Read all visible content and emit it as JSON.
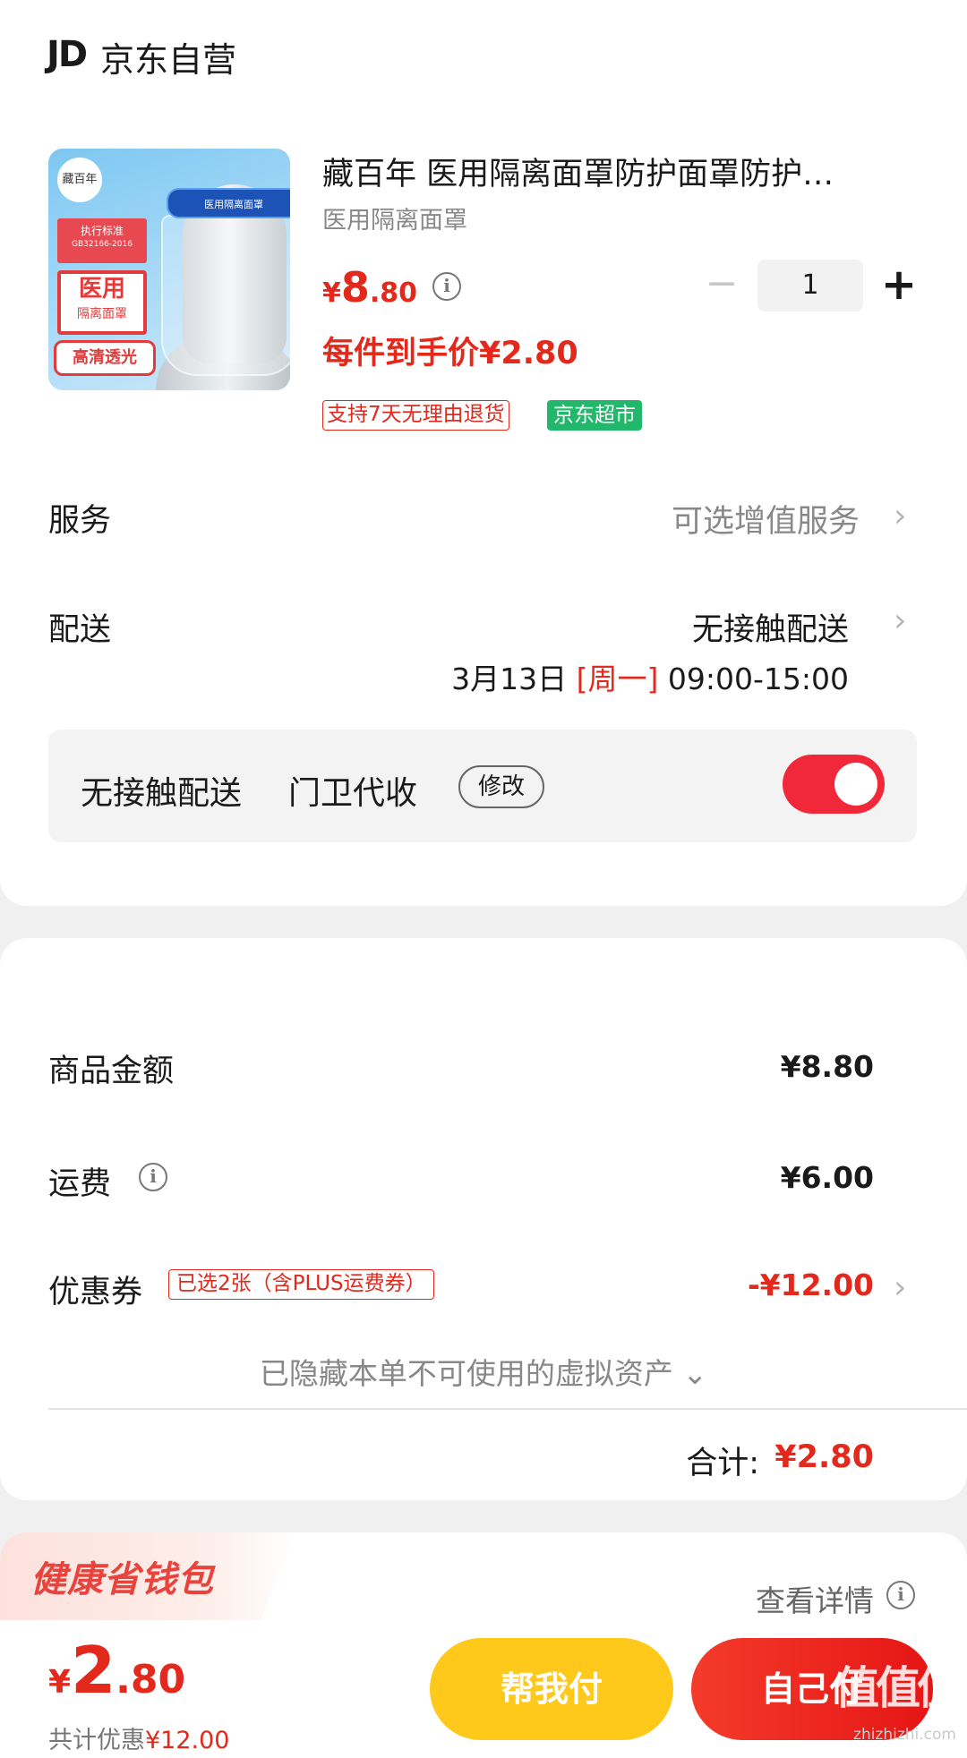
{
  "store": {
    "logo": "JD",
    "name": "京东自营"
  },
  "product": {
    "title": "藏百年 医用隔离面罩防护面罩防护…",
    "spec": "医用隔离面罩",
    "price_currency": "¥",
    "price_int": "8",
    "price_dec": ".80",
    "unit_price": "每件到手价¥2.80",
    "quantity": "1",
    "minus": "−",
    "plus": "+",
    "tags": {
      "return_policy": "支持7天无理由退货",
      "market": "京东超市"
    },
    "image_text": {
      "brand": "藏百年",
      "standard": "执行标准",
      "standard_code": "GB32166-2016",
      "med1": "医用",
      "med2": "隔离面罩",
      "hd": "高清透光",
      "band": "医用隔离面罩"
    }
  },
  "service": {
    "label": "服务",
    "value": "可选增值服务"
  },
  "delivery": {
    "label": "配送",
    "value": "无接触配送",
    "date": "3月13日 ",
    "weekday": "[周一]",
    "time": " 09:00-15:00",
    "contactless": {
      "text1": "无接触配送",
      "text2": "门卫代收",
      "modify": "修改",
      "enabled": true
    }
  },
  "summary": {
    "goods_label": "商品金额",
    "goods_value": "¥8.80",
    "shipping_label": "运费",
    "shipping_value": "¥6.00",
    "coupon_label": "优惠券",
    "coupon_tag": "已选2张（含PLUS运费券）",
    "coupon_value": "-¥12.00",
    "hidden_assets": "已隐藏本单不可使用的虚拟资产 ⌄",
    "total_label": "合计:",
    "total_value": "¥2.80"
  },
  "wallet": {
    "title": "健康省钱包",
    "view_detail": "查看详情"
  },
  "bottom": {
    "currency": "¥",
    "int": "2",
    "dec": ".80",
    "saved_prefix": "共计优惠",
    "saved_value": "¥12.00",
    "help_pay": "帮我付",
    "self_pay": "自己付"
  },
  "watermark": {
    "main": "值值值",
    "sub": "zhizhizhi.com"
  },
  "colors": {
    "accent": "#e3281c",
    "toggle": "#f0283a",
    "help_button": "#ffc91c",
    "market_tag": "#21b86b"
  }
}
